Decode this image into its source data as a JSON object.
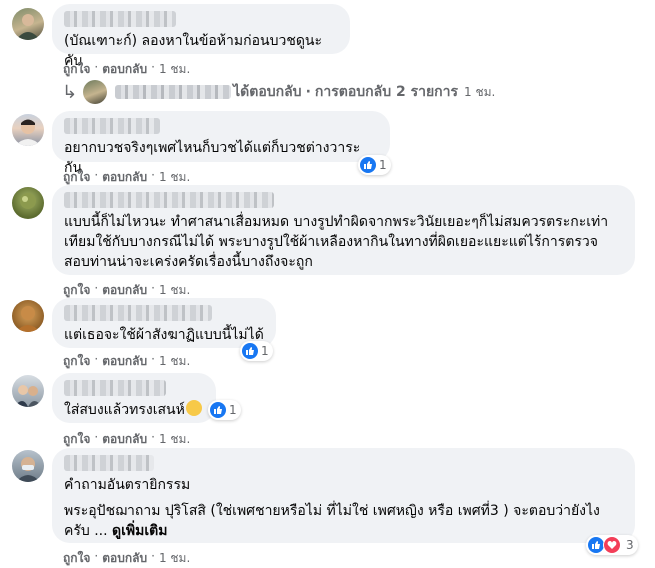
{
  "actions": {
    "like": "ถูกใจ",
    "reply": "ตอบกลับ",
    "sep": "·"
  },
  "comments": [
    {
      "text": "(บัณเฑาะก์) ลองหาในข้อห้ามก่อนบวชดูนะคับ",
      "time": "1 ชม."
    },
    {
      "text": "อยากบวชจริงๆเพศไหนก็บวชได้แต่ก็บวชต่างวาระกัน",
      "time": "1 ชม.",
      "reactions": "1"
    },
    {
      "text": "แบบนี้ก็ไม่ไหวนะ ทำศาสนาเสื่อมหมด บางรูปทำผิดจากพระวินัยเยอะๆก็ไม่สมควรตระกะเท่าเทียมใช้กับบางกรณีไม่ได้ พระบางรูปใช้ผ้าเหลืองหากินในทางที่ผิดเยอะแยะแต่ไร้การตรวจสอบท่านน่าจะเคร่งครัดเรื่องนี้บางถึงจะถูก",
      "time": "1 ชม."
    },
    {
      "text": "แต่เธอจะใช้ผ้าสังฆาฏิแบบนี้ไม่ได้",
      "time": "1 ชม.",
      "reactions": "1"
    },
    {
      "text": "ใส่สบงแล้วทรงเสนห์",
      "time": "1 ชม.",
      "reactions": "1"
    },
    {
      "text": "คำถามอันตรายิกรรม",
      "text2": "พระอุปัชฌาถาม ปุริโสสิ (ใช่เพศชายหรือไม่ ที่ไม่ใช่ เพศหญิง หรือ เพศที่3 ) จะตอบว่ายังไง",
      "text3": "ครับ ...",
      "more": "ดูเพิ่มเติม",
      "time": "1 ชม.",
      "reactions": "3"
    }
  ],
  "reply_summary": {
    "action": "ได้ตอบกลับ",
    "count_text": "การตอบกลับ 2 รายการ",
    "time": "1 ชม.",
    "arrow": "↳"
  },
  "colors": {
    "bubble": "#f0f2f5",
    "meta": "#65676b",
    "like": "#1877f2",
    "love": "#f33e58"
  }
}
